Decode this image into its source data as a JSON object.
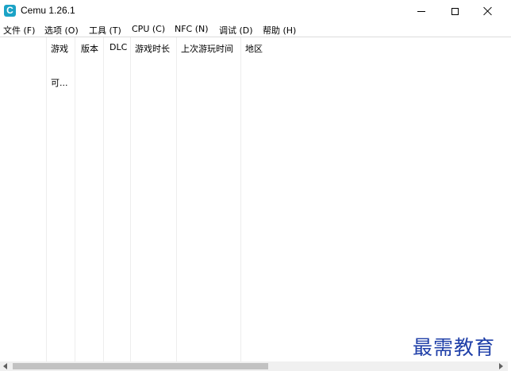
{
  "window": {
    "title": "Cemu 1.26.1",
    "icon_letter": "C"
  },
  "menu": [
    {
      "label": "文件 (F)"
    },
    {
      "label": "选项 (O)"
    },
    {
      "label": "工具 (T)"
    },
    {
      "label": "CPU (C)"
    },
    {
      "label": "NFC (N)"
    },
    {
      "label": "调试 (D)"
    },
    {
      "label": "帮助 (H)"
    }
  ],
  "columns": [
    {
      "label": "游戏"
    },
    {
      "label": "版本"
    },
    {
      "label": "DLC"
    },
    {
      "label": "游戏时长"
    },
    {
      "label": "上次游玩时间"
    },
    {
      "label": "地区"
    }
  ],
  "game_list": {
    "first_cell": "可..."
  },
  "watermark": "最需教育",
  "colors": {
    "app_icon": "#1ba3c6",
    "watermark": "#1f3fa8"
  }
}
